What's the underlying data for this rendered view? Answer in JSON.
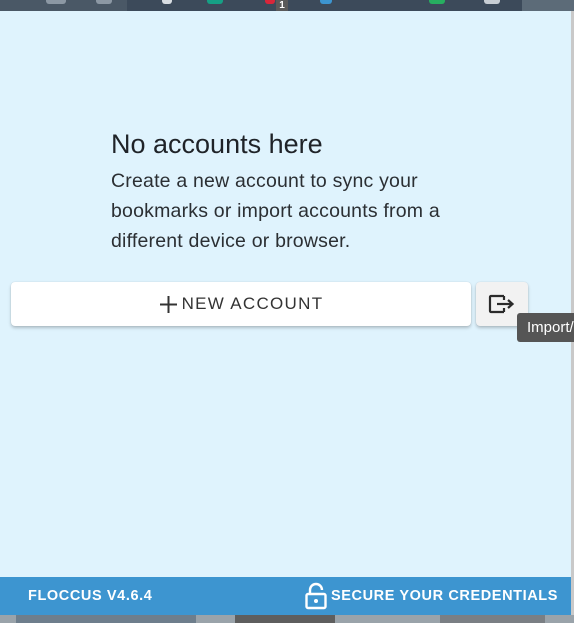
{
  "toolbar": {
    "badge_count": "1"
  },
  "empty_state": {
    "title": "No accounts here",
    "description": "Create a new account to sync your bookmarks or import accounts from a different device or browser."
  },
  "actions": {
    "new_account_label": "NEW ACCOUNT",
    "import_tooltip": "Import/"
  },
  "footer": {
    "version": "FLOCCUS V4.6.4",
    "secure_label": "SECURE YOUR CREDENTIALS"
  },
  "colors": {
    "panel_background": "#dff3fd",
    "footer_background": "#3d95d0",
    "button_background": "#ffffff",
    "text_primary": "#1f2328"
  },
  "icons": {
    "new_account": "plus-icon",
    "import": "import-export-icon",
    "secure": "lock-icon"
  }
}
